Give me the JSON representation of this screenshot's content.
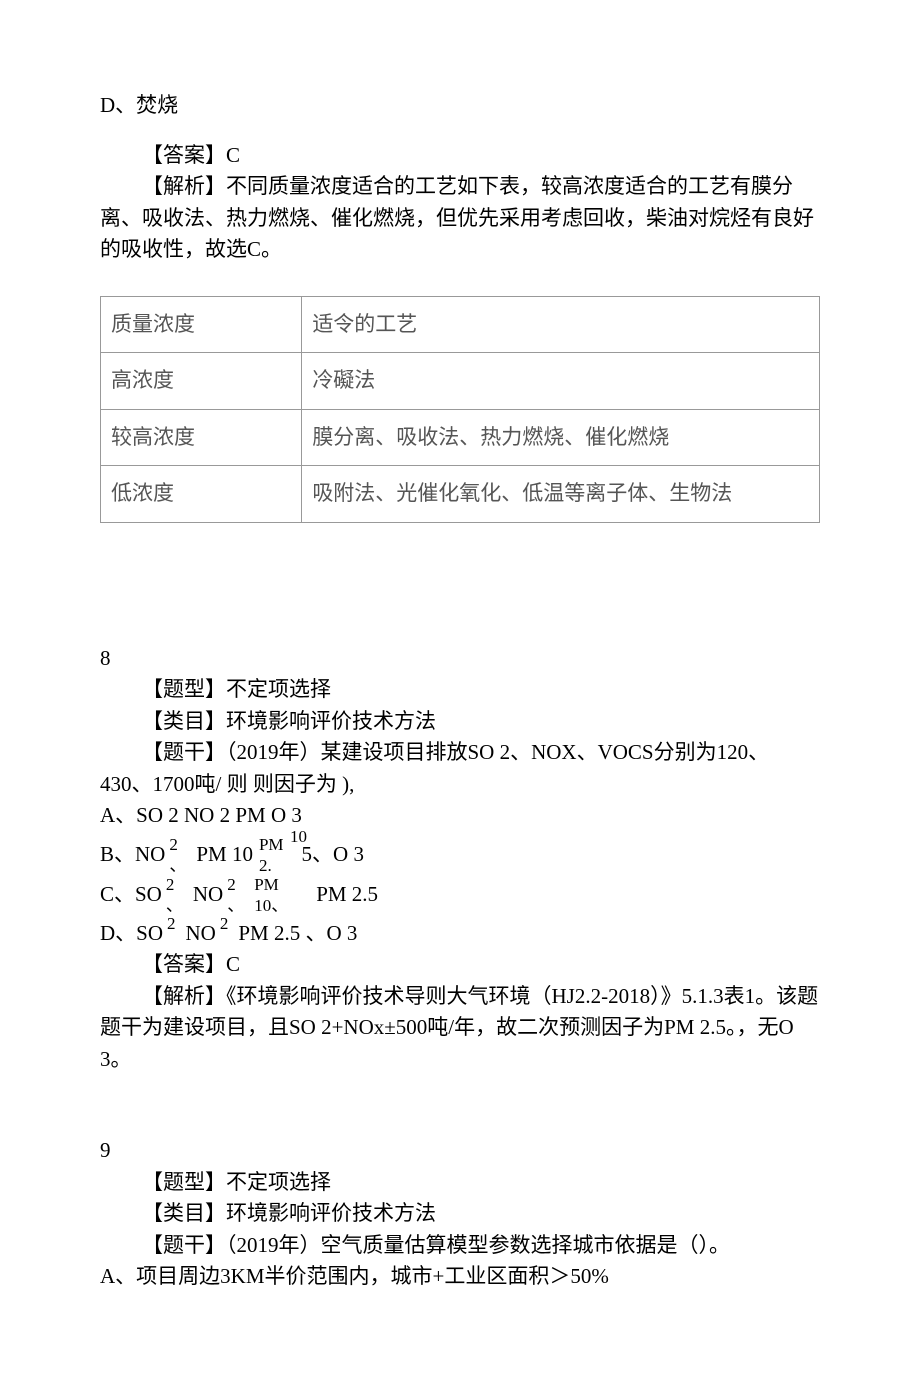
{
  "q7": {
    "option_d": "D、焚烧",
    "answer_label": "【答案】C",
    "analysis": "【解析】不同质量浓度适合的工艺如下表，较高浓度适合的工艺有膜分离、吸收法、热力燃烧、催化燃烧，但优先采用考虑回收，柴油对烷烃有良好的吸收性，故选C。",
    "table": {
      "header": [
        "质量浓度",
        "适令的工艺"
      ],
      "rows": [
        [
          "高浓度",
          "冷礙法"
        ],
        [
          "较高浓度",
          "膜分离、吸收法、热力燃烧、催化燃烧"
        ],
        [
          "低浓度",
          "吸附法、光催化氧化、低温等离子体、生物法"
        ]
      ]
    }
  },
  "q8": {
    "number": "8",
    "type_label": "【题型】不定项选择",
    "category": "【类目】环境影响评价技术方法",
    "stem": "【题干】（2019年）某建设项目排放SO 2、NOX、VOCS分别为120、430、1700吨/    则    则因子为   ),",
    "optA": "A、SO 2  NO 2  PM       O 3",
    "optA_mid": "10",
    "optB_lead": "B、NO",
    "optB_sup1": "2",
    "optB_sub1": "、",
    "optB_pm10": "PM 10",
    "optB_pm_sup": "PM",
    "optB_pm_sub": "2.",
    "optB_tail": "5、O 3",
    "optC_lead": "C、SO",
    "optC_sup1": "2",
    "optC_sub1": "、",
    "optC_no": "NO",
    "optC_sup2": "2",
    "optC_sub2": "、",
    "optC_pm": "PM",
    "optC_10": "10、",
    "optC_tail": "PM 2.5",
    "optD_lead": "D、SO",
    "optD_sup1": "2",
    "optD_no": "NO",
    "optD_sup2": "2",
    "optD_tail": "PM 2.5 、O 3",
    "answer_label": "【答案】C",
    "analysis": "【解析】《环境影响评价技术导则大气环境（HJ2.2-2018）》5.1.3表1。该题 题干为建设项目，且SO 2+NOx±500吨/年，故二次预测因子为PM 2.5。，无O 3。"
  },
  "q9": {
    "number": "9",
    "type_label": "【题型】不定项选择",
    "category": "【类目】环境影响评价技术方法",
    "stem": "【题干】（2019年）空气质量估算模型参数选择城市依据是（）。",
    "optA": "A、项目周边3KM半价范围内，城市+工业区面积＞50%"
  }
}
